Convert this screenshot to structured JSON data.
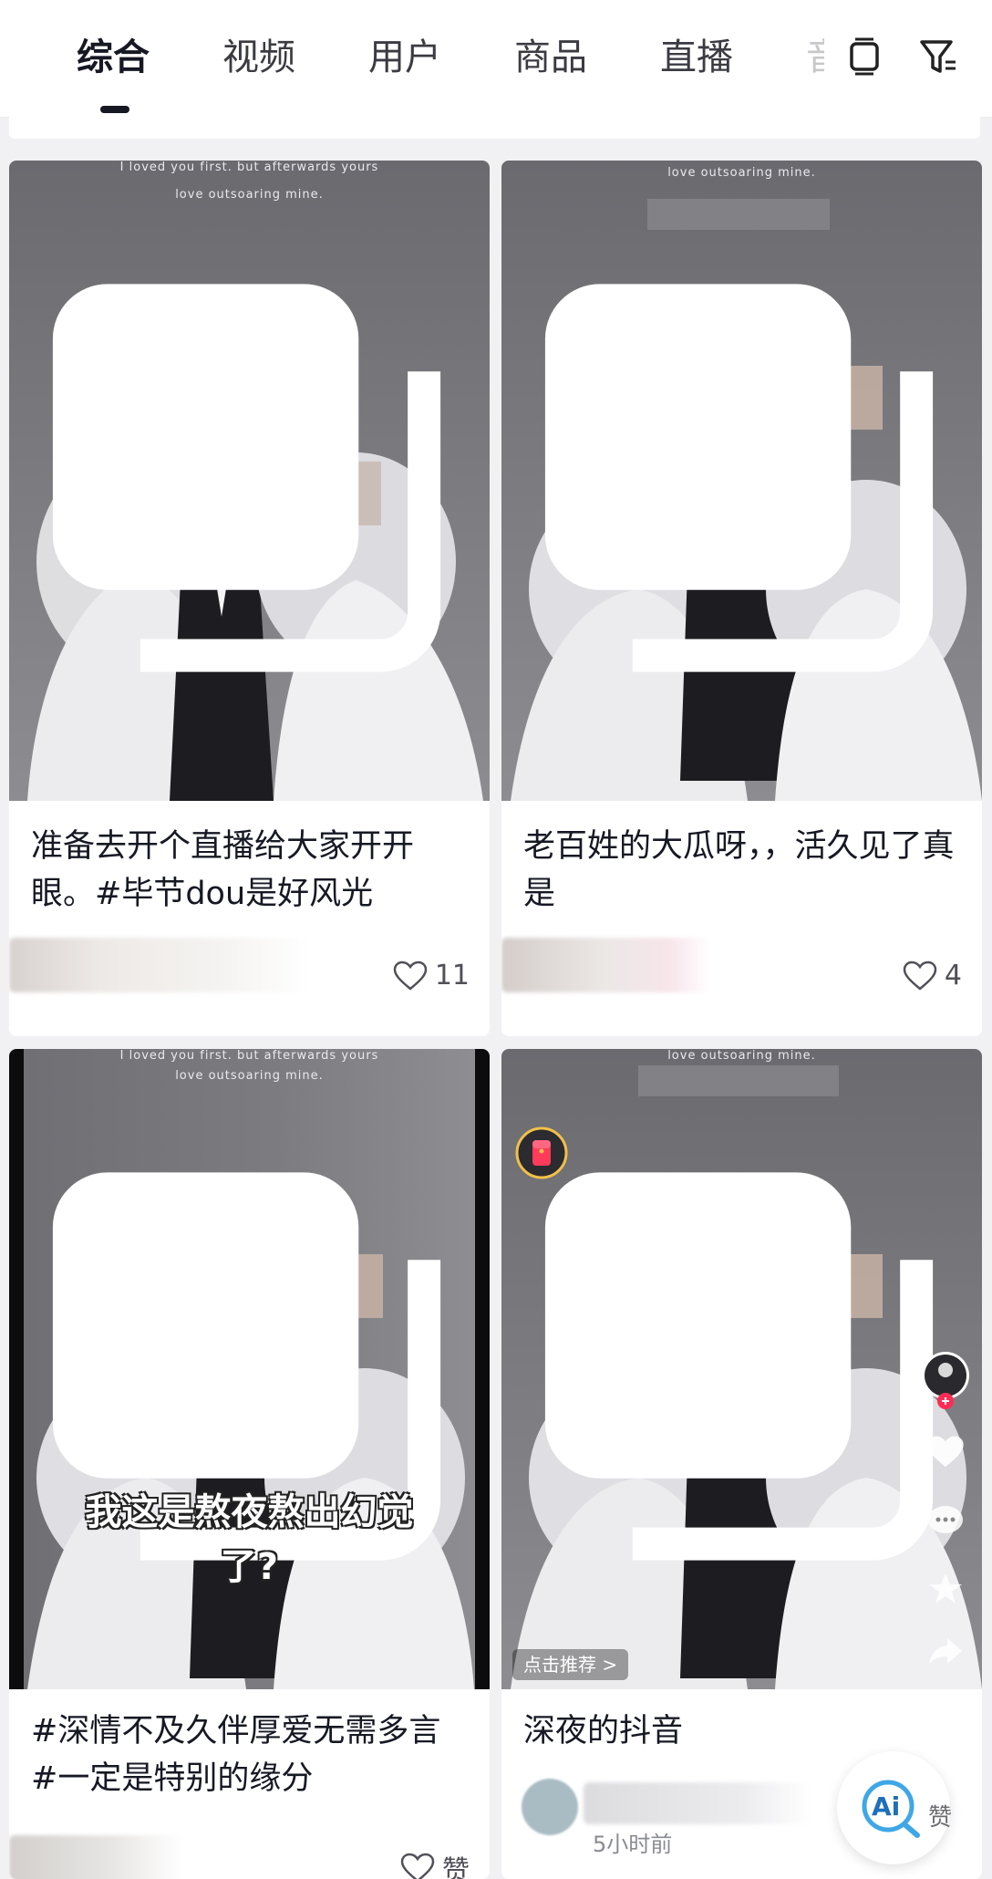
{
  "tabs": [
    "综合",
    "视频",
    "用户",
    "商品",
    "直播"
  ],
  "tab_overflow_glyph": "音",
  "cards": [
    {
      "cover_text_top": "I loved you first. but afterwards yours",
      "cover_text_second": "love outsoaring mine.",
      "caption": "准备去开个直播给大家开开眼。#毕节dou是好风光",
      "likes": "11"
    },
    {
      "cover_text_top": "love outsoaring mine.",
      "caption": "老百姓的大瓜呀，，活久见了真是",
      "likes": "4"
    },
    {
      "cover_text_top": "I loved you first. but afterwards yours",
      "cover_text_second": "love outsoaring mine.",
      "overlay_line1": "我这是熬夜熬出幻觉",
      "overlay_line2": "了?",
      "caption": "#深情不及久伴厚爱无需多言 #一定是特别的缘分",
      "likes": "赞"
    },
    {
      "cover_text_top": "love outsoaring mine.",
      "recommend_label": "点击推荐 >",
      "caption": "深夜的抖音",
      "time": "5小时前"
    }
  ],
  "ai_button_label": "Ai",
  "ai_side_glyph": "赞",
  "colors": {
    "accent": "#fe2c55",
    "text": "#161823",
    "secondary": "#8a8b91"
  }
}
